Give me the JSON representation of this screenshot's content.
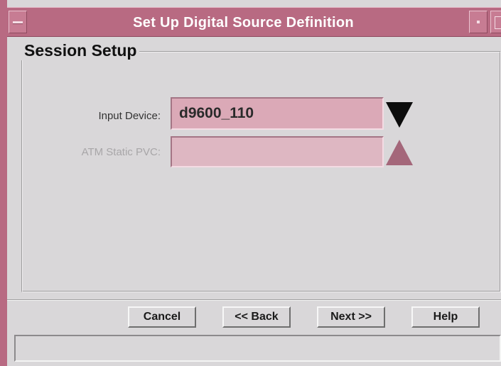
{
  "window": {
    "title": "Set Up Digital Source Definition"
  },
  "group": {
    "title": "Session Setup"
  },
  "fields": {
    "input_device": {
      "label": "Input Device:",
      "value": "d9600_110",
      "enabled": true
    },
    "atm_static_pvc": {
      "label": "ATM Static PVC:",
      "value": "",
      "enabled": false
    }
  },
  "buttons": {
    "cancel": "Cancel",
    "back": "<< Back",
    "next": "Next >>",
    "help": "Help"
  },
  "status": {
    "text": ""
  },
  "colors": {
    "title_bar": "#b86a82",
    "field_background": "#dba9b7",
    "window_background": "#d9d7d9",
    "disabled_arrow": "#a4677a"
  },
  "icons": {
    "window_menu": "window-menu-icon",
    "minimize": "minimize-icon",
    "maximize": "maximize-icon",
    "dropdown_down": "triangle-down-icon",
    "dropdown_up": "triangle-up-icon"
  }
}
